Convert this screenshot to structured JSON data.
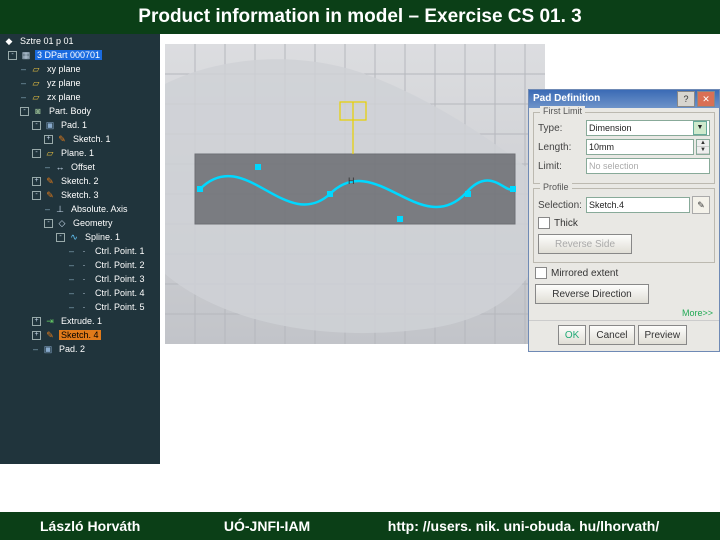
{
  "slide": {
    "title": "Product information in model – Exercise CS 01. 3",
    "footer_author": "László Horváth",
    "footer_org": "UÓ-JNFI-IAM",
    "footer_url": "http: //users. nik. uni-obuda. hu/lhorvath/"
  },
  "tree": {
    "root": "Sztre 01 p 01",
    "items": [
      {
        "indent": 0,
        "exp": "-",
        "icon": "cube-icon",
        "label": "3 DPart 000701",
        "sel": "blue"
      },
      {
        "indent": 1,
        "exp": "",
        "icon": "plane-icon",
        "label": "xy plane"
      },
      {
        "indent": 1,
        "exp": "",
        "icon": "plane-icon",
        "label": "yz plane"
      },
      {
        "indent": 1,
        "exp": "",
        "icon": "plane-icon",
        "label": "zx plane"
      },
      {
        "indent": 1,
        "exp": "-",
        "icon": "body-icon",
        "label": "Part. Body"
      },
      {
        "indent": 2,
        "exp": "-",
        "icon": "pad-icon",
        "label": "Pad. 1"
      },
      {
        "indent": 3,
        "exp": "+",
        "icon": "sketch-icon",
        "label": "Sketch. 1"
      },
      {
        "indent": 2,
        "exp": "-",
        "icon": "plane-icon",
        "label": "Plane. 1"
      },
      {
        "indent": 3,
        "exp": "",
        "icon": "offset-icon",
        "label": "Offset"
      },
      {
        "indent": 2,
        "exp": "+",
        "icon": "sketch-icon",
        "label": "Sketch. 2"
      },
      {
        "indent": 2,
        "exp": "-",
        "icon": "sketch-icon",
        "label": "Sketch. 3"
      },
      {
        "indent": 3,
        "exp": "",
        "icon": "axis-icon",
        "label": "Absolute. Axis"
      },
      {
        "indent": 3,
        "exp": "-",
        "icon": "geom-icon",
        "label": "Geometry"
      },
      {
        "indent": 4,
        "exp": "-",
        "icon": "spline-icon",
        "label": "Spline. 1"
      },
      {
        "indent": 5,
        "exp": "",
        "icon": "point-icon",
        "label": "Ctrl. Point. 1"
      },
      {
        "indent": 5,
        "exp": "",
        "icon": "point-icon",
        "label": "Ctrl. Point. 2"
      },
      {
        "indent": 5,
        "exp": "",
        "icon": "point-icon",
        "label": "Ctrl. Point. 3"
      },
      {
        "indent": 5,
        "exp": "",
        "icon": "point-icon",
        "label": "Ctrl. Point. 4"
      },
      {
        "indent": 5,
        "exp": "",
        "icon": "point-icon",
        "label": "Ctrl. Point. 5"
      },
      {
        "indent": 2,
        "exp": "+",
        "icon": "extrude-icon",
        "label": "Extrude. 1"
      },
      {
        "indent": 2,
        "exp": "+",
        "icon": "sketch-icon",
        "label": "Sketch. 4",
        "sel": "orange"
      },
      {
        "indent": 2,
        "exp": "",
        "icon": "pad-icon",
        "label": "Pad. 2"
      }
    ]
  },
  "dialog": {
    "title": "Pad Definition",
    "group_first": "First Limit",
    "type_label": "Type:",
    "type_value": "Dimension",
    "length_label": "Length:",
    "length_value": "10mm",
    "limit_label": "Limit:",
    "limit_value": "No selection",
    "group_profile": "Profile",
    "selection_label": "Selection:",
    "selection_value": "Sketch.4",
    "thick_label": "Thick",
    "reverse_side": "Reverse Side",
    "mirrored": "Mirrored extent",
    "reverse_dir": "Reverse Direction",
    "more": "More>>",
    "ok": "OK",
    "cancel": "Cancel",
    "preview": "Preview"
  },
  "colors": {
    "accent": "#00d8ff",
    "header": "#0b3f17"
  }
}
